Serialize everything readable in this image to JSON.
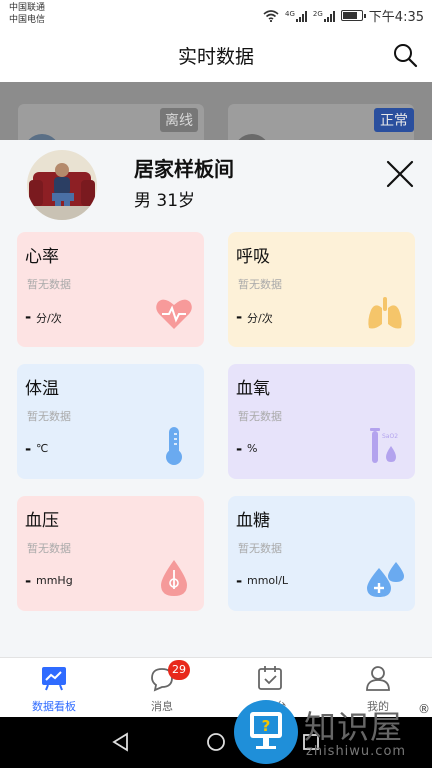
{
  "status_bar": {
    "carrier_1": "中国联通",
    "carrier_2": "中国电信",
    "net_1": "4G",
    "net_2": "2G",
    "battery_level": 0.8,
    "time": "下午4:35"
  },
  "header": {
    "title": "实时数据"
  },
  "background": {
    "badge_offline": "离线",
    "badge_normal": "正常"
  },
  "profile": {
    "name": "居家样板间",
    "meta": "男 31岁"
  },
  "vitals": [
    {
      "title": "心率",
      "no_data": "暂无数据",
      "value": "-",
      "unit": "分/次",
      "bg": "#fde3e3",
      "icon_color": "#f79a9a",
      "icon": "heart-pulse-icon"
    },
    {
      "title": "呼吸",
      "no_data": "暂无数据",
      "value": "-",
      "unit": "分/次",
      "bg": "#fdf1d8",
      "icon_color": "#f5c56a",
      "icon": "lungs-icon"
    },
    {
      "title": "体温",
      "no_data": "暂无数据",
      "value": "-",
      "unit": "℃",
      "bg": "#e4effc",
      "icon_color": "#6aaaf0",
      "icon": "thermometer-icon"
    },
    {
      "title": "血氧",
      "no_data": "暂无数据",
      "value": "-",
      "unit": "%",
      "bg": "#e7e3fa",
      "icon_color": "#b3a3ee",
      "icon": "spo2-tube-icon",
      "icon_text": "SaO2"
    },
    {
      "title": "血压",
      "no_data": "暂无数据",
      "value": "-",
      "unit": "mmHg",
      "bg": "#fde3e3",
      "icon_color": "#f59a9a",
      "icon": "blood-drop-icon"
    },
    {
      "title": "血糖",
      "no_data": "暂无数据",
      "value": "-",
      "unit": "mmol/L",
      "bg": "#e4effc",
      "icon_color": "#6aaaf0",
      "icon": "glucose-drops-icon"
    }
  ],
  "tabbar": {
    "tabs": [
      {
        "label": "数据看板",
        "active": true,
        "icon": "chart-board-icon"
      },
      {
        "label": "消息",
        "badge": "29",
        "icon": "message-icon"
      },
      {
        "label": "工作台",
        "icon": "calendar-check-icon"
      },
      {
        "label": "我的",
        "icon": "user-icon"
      }
    ]
  },
  "watermark": {
    "text": "知识屋",
    "sub": "zhishiwu.com",
    "reg": "®"
  },
  "colors": {
    "accent": "#2f6bff",
    "badge_red": "#e8291c"
  }
}
